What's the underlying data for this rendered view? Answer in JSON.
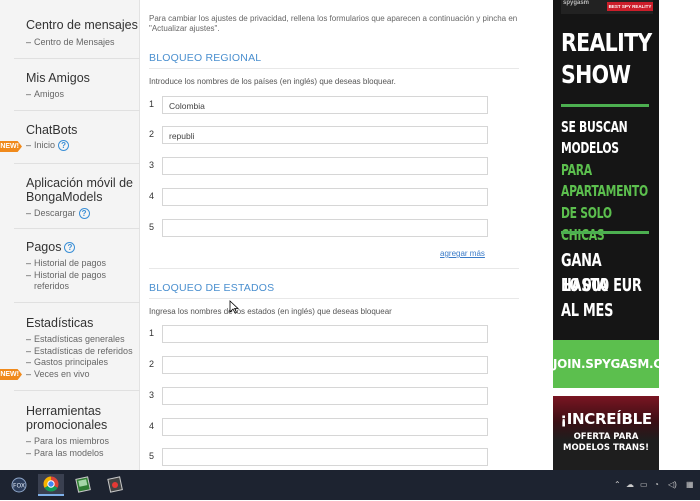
{
  "sidebar": {
    "sections": [
      {
        "title": "Centro de mensajes",
        "links": [
          "Centro de Mensajes"
        ]
      },
      {
        "title": "Mis Amigos",
        "links": [
          "Amigos"
        ]
      },
      {
        "title": "ChatBots",
        "links": [
          "Inicio"
        ]
      },
      {
        "title": "Aplicación móvil de",
        "title2": "BongaModels",
        "links": [
          "Descargar"
        ]
      },
      {
        "title": "Pagos",
        "links": [
          "Historial de pagos",
          "Historial de pagos",
          "referidos"
        ]
      },
      {
        "title": "Estadísticas",
        "links": [
          "Estadísticas generales",
          "Estadísticas de referidos",
          "Gastos principales",
          "Veces en vivo"
        ]
      },
      {
        "title": "Herramientas",
        "title2": "promocionales",
        "links": [
          "Para los miembros",
          "Para las modelos"
        ]
      }
    ],
    "new_badge": "NEW!"
  },
  "main": {
    "intro_line1": "Para cambiar los ajustes de privacidad, rellena los formularios que aparecen a continuación y pincha en",
    "intro_line2": "\"Actualizar ajustes\".",
    "regional": {
      "heading": "BLOQUEO REGIONAL",
      "description": "Introduce los nombres de los países (en inglés) que deseas bloquear.",
      "rows": [
        {
          "num": "1",
          "value": "Colombia"
        },
        {
          "num": "2",
          "value": "republi"
        },
        {
          "num": "3",
          "value": ""
        },
        {
          "num": "4",
          "value": ""
        },
        {
          "num": "5",
          "value": ""
        }
      ],
      "add_more": "agregar más"
    },
    "states": {
      "heading": "BLOQUEO DE ESTADOS",
      "description": "Ingresa los nombres de los estados (en inglés) que deseas bloquear",
      "rows": [
        {
          "num": "1",
          "value": ""
        },
        {
          "num": "2",
          "value": ""
        },
        {
          "num": "3",
          "value": ""
        },
        {
          "num": "4",
          "value": ""
        },
        {
          "num": "5",
          "value": ""
        }
      ]
    }
  },
  "ads": {
    "ad1": {
      "brand": "spygasm",
      "tag": "BEST SPY REALITY",
      "headline1": "REALITY",
      "headline2": "SHOW",
      "l1": "SE BUSCAN",
      "l2": "MODELOS",
      "l3": "PARA",
      "l4": "APARTAMENTO",
      "l5": "DE SOLO CHICAS",
      "l6": "GANA HASTA",
      "l7": "10 000 EUR",
      "l8": "AL MES",
      "cta": "JOIN.SPYGASM.COM"
    },
    "ad2": {
      "line1": "¡INCREÍBLE",
      "line2": "OFERTA PARA",
      "line3": "MODELOS TRANS!"
    }
  },
  "taskbar": {
    "icons": [
      "obs-icon",
      "chrome-icon",
      "app-icon",
      "app2-icon"
    ],
    "colors": {
      "bg": "#1d2330",
      "accent": "#4a8fcf"
    }
  }
}
